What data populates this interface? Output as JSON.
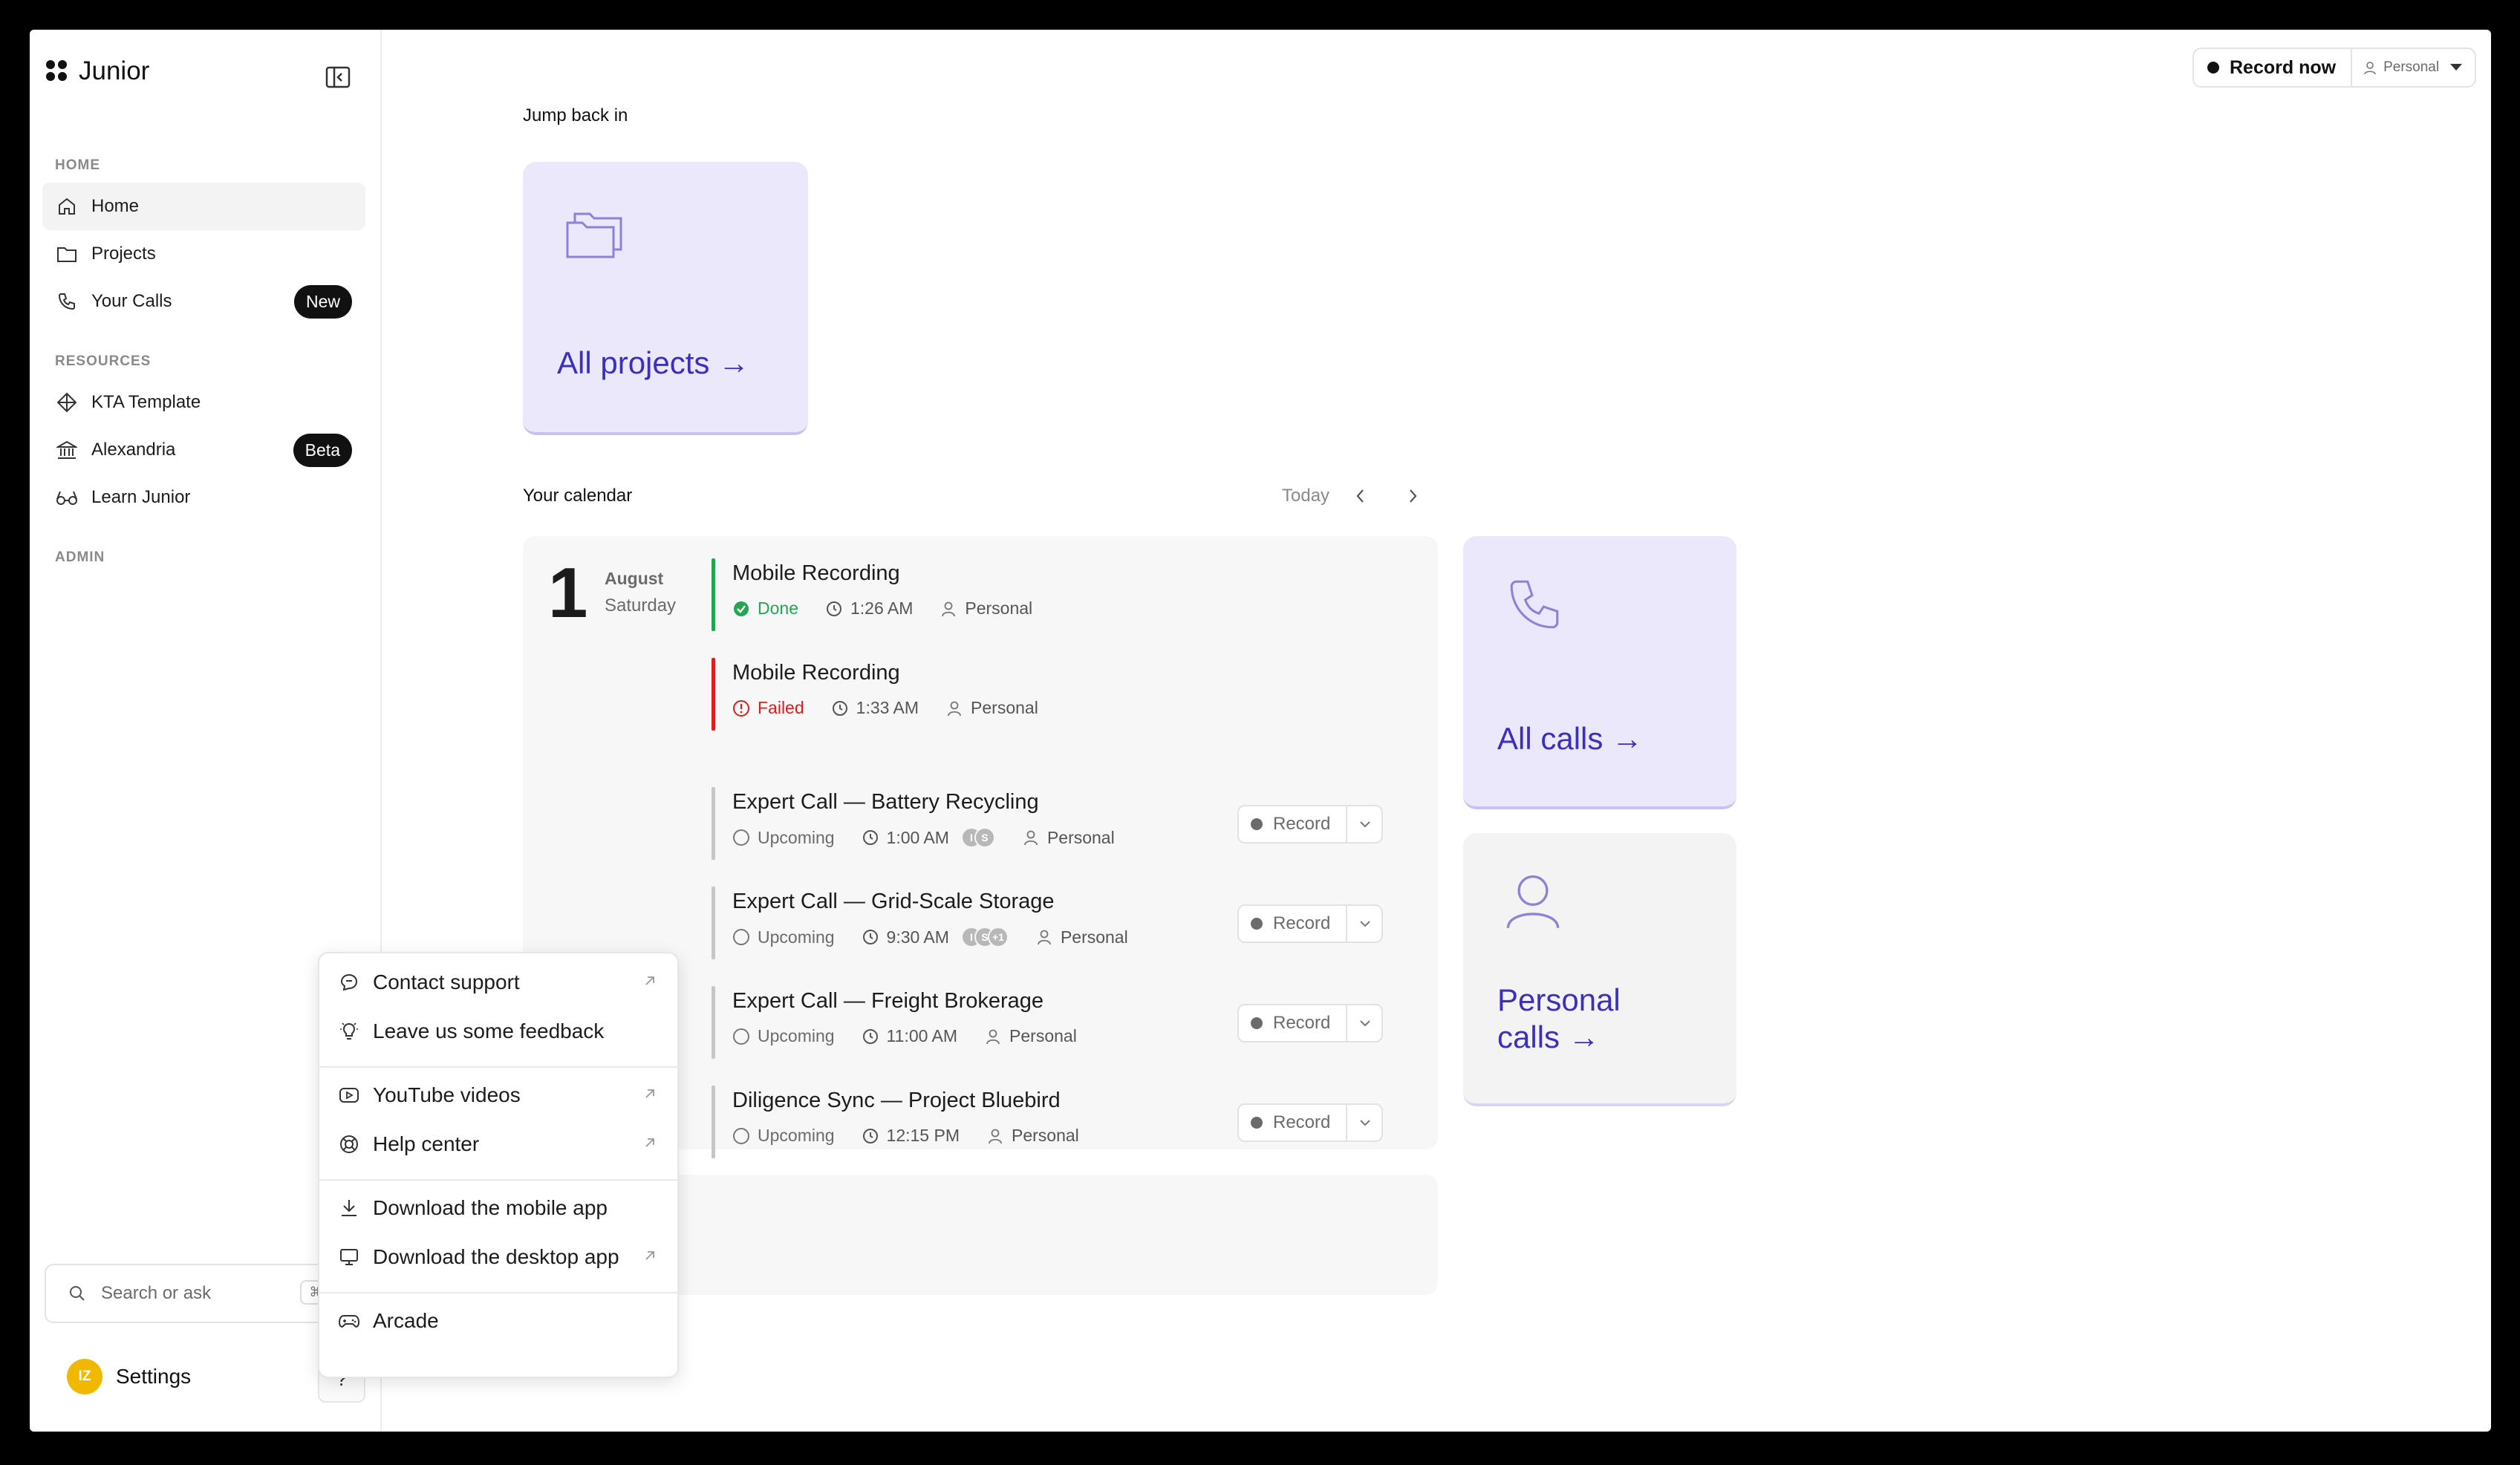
{
  "app": {
    "name": "Junior"
  },
  "sidebar": {
    "sections": {
      "home": "HOME",
      "resources": "RESOURCES",
      "admin": "ADMIN"
    },
    "home_items": [
      {
        "label": "Home",
        "icon": "home-icon"
      },
      {
        "label": "Projects",
        "icon": "folder-icon"
      },
      {
        "label": "Your Calls",
        "icon": "phone-icon",
        "badge": "New"
      }
    ],
    "resource_items": [
      {
        "label": "KTA Template",
        "icon": "diamond-icon"
      },
      {
        "label": "Alexandria",
        "icon": "library-icon",
        "badge": "Beta"
      },
      {
        "label": "Learn Junior",
        "icon": "glasses-icon"
      }
    ],
    "search": {
      "label": "Search or ask",
      "shortcut": "⌘ +"
    },
    "settings": {
      "label": "Settings",
      "avatar_initials": "IZ"
    },
    "help": "?"
  },
  "help_menu": {
    "items": [
      {
        "label": "Contact support",
        "icon": "chat-icon",
        "external": true
      },
      {
        "label": "Leave us some feedback",
        "icon": "lightbulb-icon",
        "external": false
      },
      {
        "label": "YouTube videos",
        "icon": "youtube-icon",
        "external": true
      },
      {
        "label": "Help center",
        "icon": "lifebuoy-icon",
        "external": true
      },
      {
        "label": "Download the mobile app",
        "icon": "download-icon",
        "external": false
      },
      {
        "label": "Download the desktop app",
        "icon": "monitor-icon",
        "external": true
      },
      {
        "label": "Arcade",
        "icon": "gamepad-icon",
        "external": false
      }
    ]
  },
  "header": {
    "record_now": "Record now",
    "workspace": "Personal"
  },
  "jump_back": {
    "title": "Jump back in",
    "all_projects": "All projects →"
  },
  "calendar": {
    "title": "Your calendar",
    "today": "Today",
    "date": {
      "day": "1",
      "month": "August",
      "weekday": "Saturday"
    },
    "events": [
      {
        "title": "Mobile Recording",
        "status": "Done",
        "time": "1:26 AM",
        "owner": "Personal"
      },
      {
        "title": "Mobile Recording",
        "status": "Failed",
        "time": "1:33 AM",
        "owner": "Personal"
      },
      {
        "title": "Expert Call — Battery Recycling",
        "status": "Upcoming",
        "time": "1:00 AM",
        "owner": "Personal",
        "avatars": [
          "I",
          "S"
        ],
        "record": "Record"
      },
      {
        "title": "Expert Call — Grid-Scale Storage",
        "status": "Upcoming",
        "time": "9:30 AM",
        "owner": "Personal",
        "avatars": [
          "I",
          "S",
          "+1"
        ],
        "record": "Record"
      },
      {
        "title": "Expert Call — Freight Brokerage",
        "status": "Upcoming",
        "time": "11:00 AM",
        "owner": "Personal",
        "record": "Record"
      },
      {
        "title": "Diligence Sync — Project Bluebird",
        "status": "Upcoming",
        "time": "12:15 PM",
        "owner": "Personal",
        "record": "Record"
      }
    ]
  },
  "cards": {
    "all_calls": "All calls →",
    "personal_calls_1": "Personal",
    "personal_calls_2": "calls →"
  },
  "colors": {
    "accent": "#3b2fbf",
    "card_purple": "#ebe8fb",
    "done": "#22a652",
    "failed": "#e01d1d"
  }
}
